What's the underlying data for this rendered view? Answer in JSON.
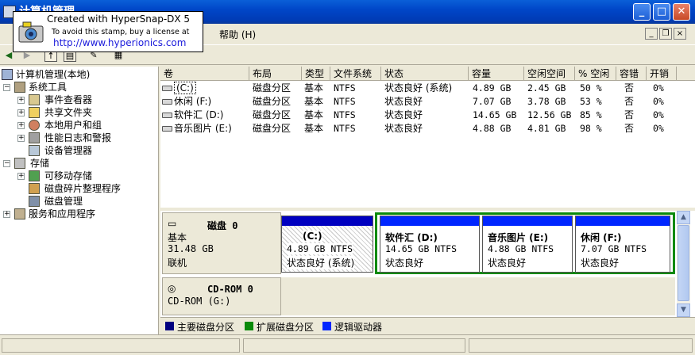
{
  "window": {
    "title": "计算机管理"
  },
  "watermark": {
    "line1": "Created with HyperSnap-DX 5",
    "line2": "To avoid this stamp, buy a license at",
    "line3": "http://www.hyperionics.com"
  },
  "menu": {
    "view_suffix": ")",
    "help": "帮助 (H)"
  },
  "tree": {
    "root": "计算机管理(本地)",
    "system_tools": "系统工具",
    "event_viewer": "事件查看器",
    "shared_folders": "共享文件夹",
    "local_users": "本地用户和组",
    "perf_logs": "性能日志和警报",
    "device_manager": "设备管理器",
    "storage": "存储",
    "removable": "可移动存储",
    "defrag": "磁盘碎片整理程序",
    "disk_mgmt": "磁盘管理",
    "services": "服务和应用程序"
  },
  "volumes": {
    "headers": [
      "卷",
      "布局",
      "类型",
      "文件系统",
      "状态",
      "容量",
      "空闲空间",
      "% 空闲",
      "容错",
      "开销"
    ],
    "rows": [
      {
        "name": "(C:)",
        "layout": "磁盘分区",
        "type": "基本",
        "fs": "NTFS",
        "status": "状态良好 (系统)",
        "capacity": "4.89 GB",
        "free": "2.45 GB",
        "pct": "50 %",
        "fault": "否",
        "overhead": "0%"
      },
      {
        "name": "休闲 (F:)",
        "layout": "磁盘分区",
        "type": "基本",
        "fs": "NTFS",
        "status": "状态良好",
        "capacity": "7.07 GB",
        "free": "3.78 GB",
        "pct": "53 %",
        "fault": "否",
        "overhead": "0%"
      },
      {
        "name": "软件汇 (D:)",
        "layout": "磁盘分区",
        "type": "基本",
        "fs": "NTFS",
        "status": "状态良好",
        "capacity": "14.65 GB",
        "free": "12.56 GB",
        "pct": "85 %",
        "fault": "否",
        "overhead": "0%"
      },
      {
        "name": "音乐图片 (E:)",
        "layout": "磁盘分区",
        "type": "基本",
        "fs": "NTFS",
        "status": "状态良好",
        "capacity": "4.88 GB",
        "free": "4.81 GB",
        "pct": "98 %",
        "fault": "否",
        "overhead": "0%"
      }
    ]
  },
  "disk0": {
    "name": "磁盘 0",
    "kind": "基本",
    "size": "31.48 GB",
    "state": "联机",
    "partitions": [
      {
        "title": "(C:)",
        "size": "4.89 GB NTFS",
        "status": "状态良好 (系统)"
      },
      {
        "title": "软件汇   (D:)",
        "size": "14.65 GB NTFS",
        "status": "状态良好"
      },
      {
        "title": "音乐图片   (E:)",
        "size": "4.88 GB NTFS",
        "status": "状态良好"
      },
      {
        "title": "休闲   (F:)",
        "size": "7.07 GB NTFS",
        "status": "状态良好"
      }
    ]
  },
  "cdrom": {
    "name": "CD-ROM 0",
    "sub": "CD-ROM (G:)"
  },
  "legend": {
    "primary": "主要磁盘分区",
    "extended": "扩展磁盘分区",
    "logical": "逻辑驱动器"
  },
  "colors": {
    "primary": "#000080",
    "extended": "#0a8a0a",
    "logical": "#0026ff"
  }
}
